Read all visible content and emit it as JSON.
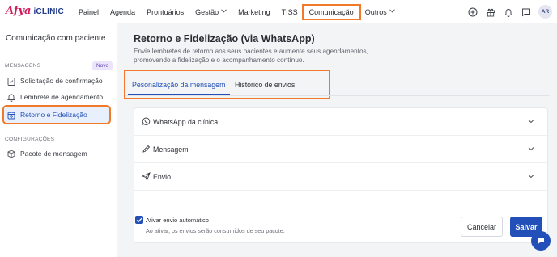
{
  "logo": {
    "brand": "Afya",
    "product": "iCLINIC"
  },
  "nav": {
    "items": [
      {
        "label": "Painel"
      },
      {
        "label": "Agenda"
      },
      {
        "label": "Prontuários"
      },
      {
        "label": "Gestão"
      },
      {
        "label": "Marketing"
      },
      {
        "label": "TISS"
      },
      {
        "label": "Comunicação"
      },
      {
        "label": "Outros"
      }
    ],
    "user_initials": "AR",
    "icons": [
      "add-circle-icon",
      "gift-icon",
      "bell-icon",
      "chat-icon"
    ]
  },
  "sidebar": {
    "title": "Comunicação com paciente",
    "sections": [
      {
        "label": "MENSAGENS",
        "badge": "Novo"
      },
      {
        "label": "CONFIGURAÇÕES"
      }
    ],
    "items": [
      {
        "label": "Solicitação de confirmação",
        "icon": "clipboard-check-icon"
      },
      {
        "label": "Lembrete de agendamento",
        "icon": "bell-icon"
      },
      {
        "label": "Retorno e Fidelização",
        "icon": "calendar-icon",
        "active": true
      },
      {
        "label": "Pacote de mensagem",
        "icon": "package-icon"
      }
    ]
  },
  "main": {
    "title": "Retorno e Fidelização (via WhatsApp)",
    "description": "Envie lembretes de retorno aos seus pacientes e aumente seus agendamentos, promovendo a fidelização e o acompanhamento contínuo.",
    "tabs": [
      {
        "label": "Pesonalização da mensagem",
        "active": true
      },
      {
        "label": "Histórico de envios"
      }
    ],
    "accordion": [
      {
        "label": "WhatsApp da clínica",
        "icon": "whatsapp-icon"
      },
      {
        "label": "Mensagem",
        "icon": "pencil-icon"
      },
      {
        "label": "Envio",
        "icon": "send-icon"
      }
    ],
    "auto_send": {
      "label": "Ativar envio automático",
      "help": "Ao ativar, os envios serão consumidos de seu pacote.",
      "checked": true
    },
    "buttons": {
      "cancel": "Cancelar",
      "save": "Salvar"
    }
  },
  "colors": {
    "primary": "#2350b8",
    "highlight": "#f07a2a",
    "brand_pink": "#d11a5b"
  }
}
